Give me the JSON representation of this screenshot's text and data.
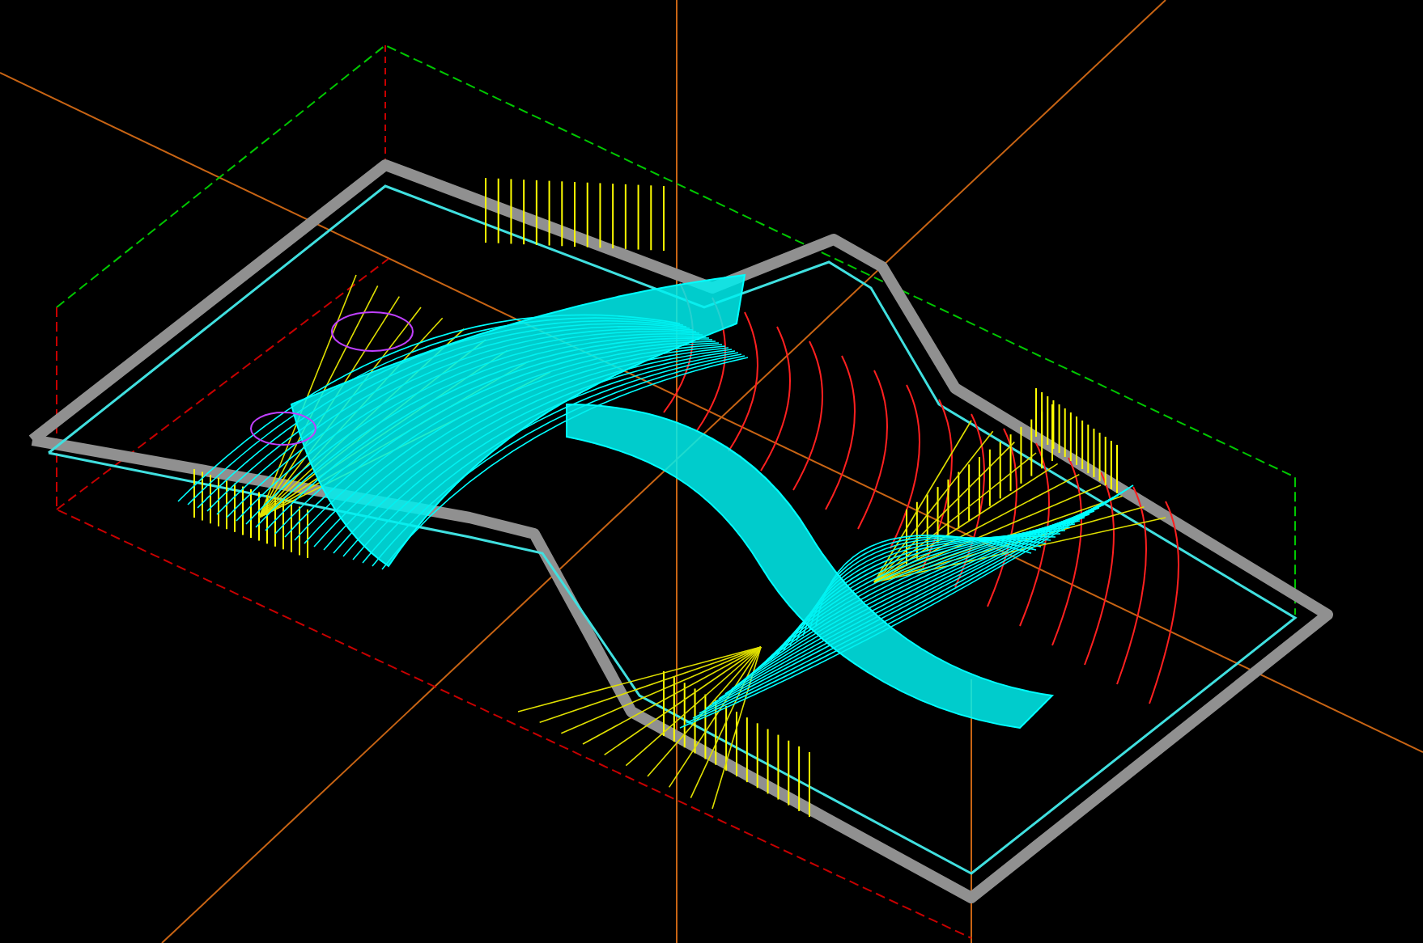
{
  "viewport": {
    "kind": "toolpath-3d"
  }
}
